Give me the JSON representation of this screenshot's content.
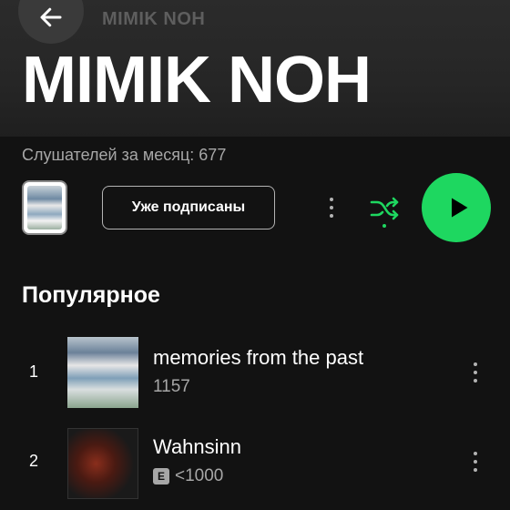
{
  "header": {
    "back_icon": "arrow-left-icon",
    "top_title": "MIMIK NOH",
    "big_title": "MIMIK NOH"
  },
  "artist": {
    "monthly_listeners": "Слушателей за месяц: 677",
    "follow_label": "Уже подписаны",
    "more_icon": "more-vertical-icon",
    "shuffle_icon": "shuffle-icon",
    "play_icon": "play-icon"
  },
  "popular": {
    "section_title": "Популярное",
    "tracks": [
      {
        "number": "1",
        "title": "memories from the past",
        "plays": "1157",
        "explicit": false
      },
      {
        "number": "2",
        "title": "Wahnsinn",
        "plays": "<1000",
        "explicit": true,
        "explicit_label": "E"
      }
    ]
  },
  "colors": {
    "accent": "#1ed760",
    "background": "#121212",
    "secondary_text": "#a7a7a7"
  }
}
